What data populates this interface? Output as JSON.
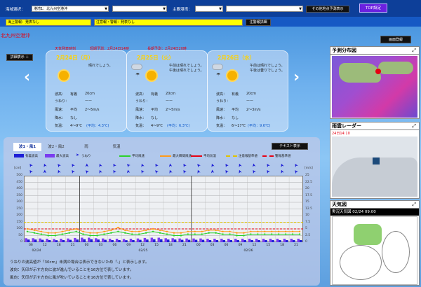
{
  "topbar": {
    "station_label": "海域選択：",
    "station_value": "港湾1：北九州空港沖",
    "port_label": "主要港湾：",
    "other_btn": "その他地点予測表示",
    "top_btn": "TOP設定"
  },
  "warnings": {
    "sea_warning": "海上警報：発表なし",
    "advisory": "注意報・警報：発表なし",
    "btn": "注警報詳細"
  },
  "register_btn": "画面登録",
  "point_title": "北九州空港沖",
  "history_btn": "詳細表示 ＋",
  "issued": {
    "short": "天気発表時刻",
    "wave": "短期予測：2月24日14時",
    "long": "長期予測：2月24日20時"
  },
  "days": [
    {
      "date": "2月24日（月）",
      "desc": "晴れでしょう。",
      "wave": "20cm",
      "swell": "ーー",
      "wind": "2～5m/s",
      "precip": "なし",
      "temp": "4～9℃",
      "temp_avg": "(平均：4.3℃)"
    },
    {
      "date": "2月25日（火）",
      "desc": "午前は晴れでしょう。午後は晴れでしょう。",
      "wave": "20cm",
      "swell": "ーー",
      "wind": "2～5m/s",
      "precip": "なし",
      "temp": "4～9℃",
      "temp_avg": "(平均：6.3℃)"
    },
    {
      "date": "2月26日（水）",
      "desc": "午前は晴れでしょう。午後は曇りでしょう。",
      "wave": "20cm",
      "swell": "ーー",
      "wind": "2～3m/s",
      "precip": "なし",
      "temp": "6～17℃",
      "temp_avg": "(平均：9.6℃)"
    }
  ],
  "labels": {
    "wave": "波高：",
    "dir": "有義",
    "swell": "うねり：",
    "wind": "風速：",
    "avg": "平均",
    "precip": "降水：",
    "temp": "気温："
  },
  "tabs": [
    "波1・風1",
    "波2・風2",
    "雨",
    "気温"
  ],
  "text_btn": "テキスト表示",
  "legend": [
    "有義波高",
    "最大波高",
    "うねり",
    "平均風速",
    "最大瞬間風速",
    "平均気温",
    "注意報基準値",
    "警報基準値"
  ],
  "yaxis_left": [
    "500",
    "450",
    "400",
    "350",
    "300",
    "250",
    "200",
    "150",
    "100",
    "50",
    "0"
  ],
  "yaxis_right": [
    "25",
    "22.5",
    "20",
    "17.5",
    "15",
    "12.5",
    "10",
    "7.5",
    "5",
    "2.5",
    "0"
  ],
  "y_unit_left": "[cm]",
  "y_unit_right": "[m/s]",
  "xticks": [
    "06",
    "12",
    "18",
    "21",
    "00",
    "03",
    "06",
    "09",
    "12",
    "15",
    "18",
    "21",
    "00",
    "03",
    "06",
    "09",
    "12",
    "15",
    "18",
    "21"
  ],
  "date_labels": [
    "02/24",
    "02/25",
    "02/26"
  ],
  "notes": [
    "うねりの波高値が「30cm」未満の場合は表示できないため「-」と表示します。",
    "波向：矢印が示す方向に波が進んでいることを16方位で表しています。",
    "風向：矢印が示す方向に風が吹いていることを16方位で表しています。"
  ],
  "right": {
    "p1": "予測分布図",
    "p2": "雨雲レーダー",
    "p2_time": "24日14:10",
    "p3": "天気図",
    "p3_sub": "実況天気図 02/24 09:00"
  },
  "colors": {
    "accent": "#0d3f99",
    "warn": "#ffff00",
    "bar": "#1d1fd6",
    "line_green": "#2ad12a",
    "line_orange": "#ff9a1a",
    "line_red": "#e60012"
  },
  "chart_data": {
    "type": "bar",
    "series": [
      {
        "name": "有義波高",
        "values": [
          20,
          20,
          18,
          16,
          15,
          16,
          18,
          20,
          22,
          22,
          20,
          18,
          16,
          16,
          15,
          16,
          18,
          20,
          22,
          22,
          20,
          20,
          18,
          18,
          18,
          18,
          16,
          16,
          16,
          16,
          16,
          16,
          16,
          16,
          16,
          16,
          16,
          16,
          16,
          16
        ]
      },
      {
        "name": "最大波高",
        "values": [
          30,
          30,
          28,
          26,
          24,
          26,
          28,
          32,
          34,
          34,
          30,
          28,
          26,
          26,
          24,
          26,
          28,
          32,
          34,
          34,
          30,
          30,
          28,
          28,
          28,
          28,
          26,
          26,
          26,
          26,
          26,
          26,
          26,
          26,
          26,
          26,
          26,
          26,
          26,
          26
        ]
      },
      {
        "name": "平均風速",
        "values": [
          4,
          3.5,
          3,
          2.5,
          2.5,
          3,
          3.5,
          4,
          3,
          2.5,
          2.5,
          3,
          3.5,
          4,
          3.5,
          3,
          3,
          3.5,
          4,
          3.5,
          3,
          2.5,
          2.5,
          3,
          3,
          3,
          3.5,
          3.5,
          3,
          3,
          2.5,
          2.5,
          3,
          3,
          3,
          3,
          3,
          3,
          3,
          3
        ]
      },
      {
        "name": "最大瞬間風速",
        "values": [
          5,
          4.5,
          4,
          3.5,
          3.5,
          4,
          4.5,
          5,
          4,
          3.5,
          3.5,
          4,
          4.5,
          5.5,
          4.5,
          4,
          4,
          4.5,
          5,
          4.5,
          4,
          3.5,
          3.5,
          4,
          4,
          4,
          4.5,
          4.5,
          4,
          4,
          3.5,
          3.5,
          4,
          4,
          4,
          4,
          4,
          4,
          4,
          4
        ]
      },
      {
        "name": "注意報基準値",
        "values": [
          150
        ]
      },
      {
        "name": "警報基準値",
        "values": [
          100
        ]
      }
    ],
    "ylim": [
      0,
      500
    ],
    "y2lim": [
      0,
      25
    ]
  }
}
